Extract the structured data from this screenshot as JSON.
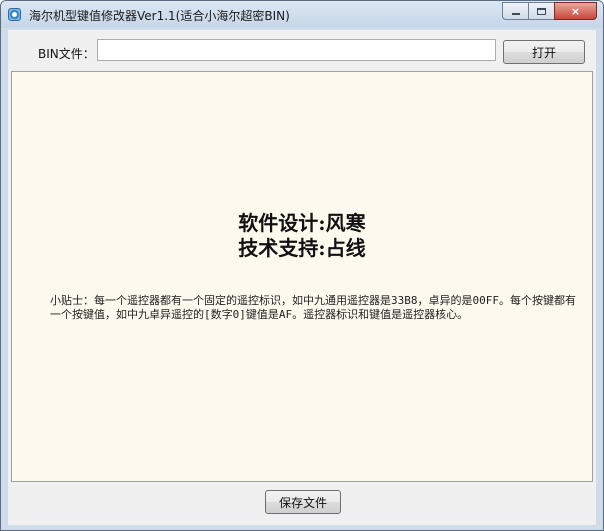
{
  "window": {
    "title": "海尔机型键值修改器Ver1.1(适合小海尔超密BIN)",
    "app_icon": "app-icon",
    "controls": {
      "minimize": "minimize-icon",
      "maximize": "maximize-icon",
      "close": "×"
    }
  },
  "file_row": {
    "label": "BIN文件：",
    "value": "",
    "placeholder": "",
    "open_button": "打开"
  },
  "panel": {
    "credits": [
      "软件设计:风寒",
      "技术支持:占线"
    ],
    "tip": "小贴士：每一个遥控器都有一个固定的遥控标识，如中九通用遥控器是33B8，卓异的是00FF。每个按键都有一个按键值，如中九卓异遥控的[数字0]键值是AF。遥控器标识和键值是遥控器核心。",
    "background_color": "#fdf9ee"
  },
  "footer": {
    "save_button": "保存文件"
  }
}
